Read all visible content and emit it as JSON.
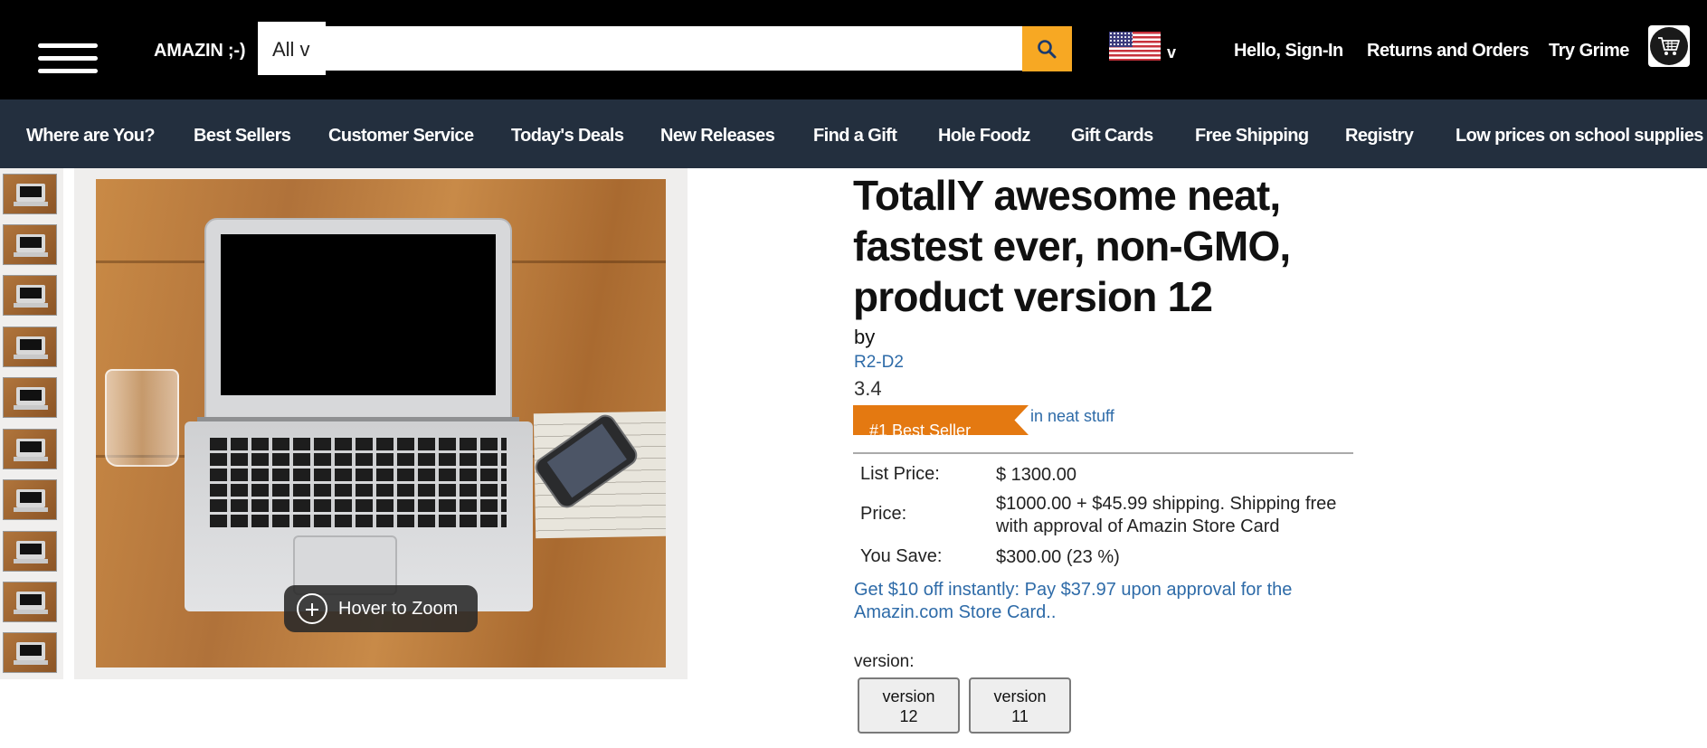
{
  "header": {
    "logo": "AMAZIN ;-)",
    "search_category": "All v",
    "search_value": "",
    "flag_caret": "v",
    "links": [
      "Hello, Sign-In",
      "Returns and Orders",
      "Try Grime"
    ]
  },
  "nav": {
    "items": [
      "Where are You?",
      "Best Sellers",
      "Customer Service",
      "Today's Deals",
      "New Releases",
      "Find a Gift",
      "Hole Foodz",
      "Gift Cards",
      "Free Shipping",
      "Registry",
      "Low prices on school supplies"
    ]
  },
  "gallery": {
    "zoom_label": "Hover to Zoom"
  },
  "product": {
    "title": "TotallY awesome neat, fastest ever, non-GMO, product version 12",
    "by_label": "by",
    "brand": "R2-D2",
    "rating": "3.4",
    "badge": "#1 Best Seller",
    "badge_category": "in neat stuff",
    "pricing": {
      "list_label": "List Price:",
      "list_value": "$ 1300.00",
      "price_label": "Price:",
      "price_value": "$1000.00 + $45.99 shipping. Shipping free with approval of Amazin Store Card",
      "save_label": "You Save:",
      "save_value": "$300.00 (23 %)"
    },
    "promo": "Get $10 off instantly: Pay $37.97 upon approval for the Amazin.com Store Card..",
    "version_label": "version:",
    "versions": [
      {
        "line1": "version",
        "line2": "12"
      },
      {
        "line1": "version",
        "line2": "11"
      }
    ]
  },
  "colors": {
    "header_bg": "#000000",
    "nav_bg": "#232f3e",
    "search_button": "#f7a823",
    "badge": "#e47911",
    "link": "#2e6ba8"
  },
  "icons": [
    "menu-icon",
    "search-icon",
    "us-flag-icon",
    "cart-icon",
    "zoom-plus-icon"
  ]
}
